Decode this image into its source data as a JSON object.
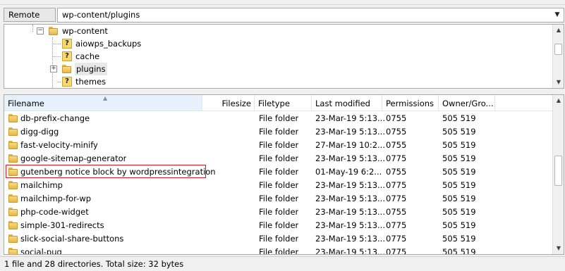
{
  "remote_site": {
    "label": "Remote site:",
    "path": "wp-content/plugins"
  },
  "tree": {
    "items": [
      {
        "label": "wp-content",
        "kind": "folder",
        "expander": "−"
      },
      {
        "label": "aiowps_backups",
        "kind": "unknown"
      },
      {
        "label": "cache",
        "kind": "unknown"
      },
      {
        "label": "plugins",
        "kind": "folder",
        "expander": "+",
        "selected": true
      },
      {
        "label": "themes",
        "kind": "unknown"
      }
    ]
  },
  "columns": [
    "Filename",
    "Filesize",
    "Filetype",
    "Last modified",
    "Permissions",
    "Owner/Gro..."
  ],
  "files": [
    {
      "name": "db-prefix-change",
      "type": "File folder",
      "modified": "23-Mar-19 5:13...",
      "perms": "0755",
      "owner": "505 519"
    },
    {
      "name": "digg-digg",
      "type": "File folder",
      "modified": "23-Mar-19 5:13...",
      "perms": "0755",
      "owner": "505 519"
    },
    {
      "name": "fast-velocity-minify",
      "type": "File folder",
      "modified": "27-Mar-19 10:2...",
      "perms": "0755",
      "owner": "505 519"
    },
    {
      "name": "google-sitemap-generator",
      "type": "File folder",
      "modified": "23-Mar-19 5:13...",
      "perms": "0775",
      "owner": "505 519"
    },
    {
      "name": "gutenberg notice block by wordpressintegration",
      "type": "File folder",
      "modified": "01-May-19 6:2...",
      "perms": "0755",
      "owner": "505 519",
      "highlighted": true
    },
    {
      "name": "mailchimp",
      "type": "File folder",
      "modified": "23-Mar-19 5:13...",
      "perms": "0775",
      "owner": "505 519"
    },
    {
      "name": "mailchimp-for-wp",
      "type": "File folder",
      "modified": "23-Mar-19 5:13...",
      "perms": "0775",
      "owner": "505 519"
    },
    {
      "name": "php-code-widget",
      "type": "File folder",
      "modified": "23-Mar-19 5:13...",
      "perms": "0755",
      "owner": "505 519"
    },
    {
      "name": "simple-301-redirects",
      "type": "File folder",
      "modified": "23-Mar-19 5:13...",
      "perms": "0775",
      "owner": "505 519"
    },
    {
      "name": "slick-social-share-buttons",
      "type": "File folder",
      "modified": "23-Mar-19 5:13...",
      "perms": "0775",
      "owner": "505 519"
    },
    {
      "name": "social-pug",
      "type": "File folder",
      "modified": "23-Mar-19 5:13...",
      "perms": "0775",
      "owner": "505 519"
    }
  ],
  "status": "1 file and 28 directories. Total size: 32 bytes",
  "colors": {
    "highlight_border": "#d9191f",
    "sorted_header": "#e6f1fb",
    "folder": "#e6b844"
  }
}
